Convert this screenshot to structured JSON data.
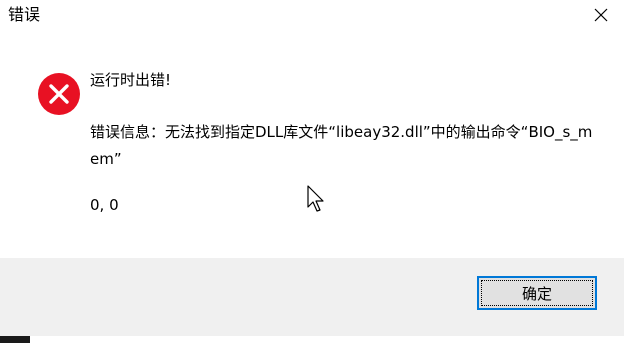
{
  "window": {
    "title": "错误",
    "close_icon": "close-icon"
  },
  "message": {
    "icon": "error-circle-icon",
    "icon_color": "#e81123",
    "heading": "运行时出错!",
    "body": "错误信息：无法找到指定DLL库文件“libeay32.dll”中的输出命令“BIO_s_mem”",
    "extra": "0, 0"
  },
  "buttons": {
    "ok_label": "确定",
    "accent": "#0078d7"
  }
}
